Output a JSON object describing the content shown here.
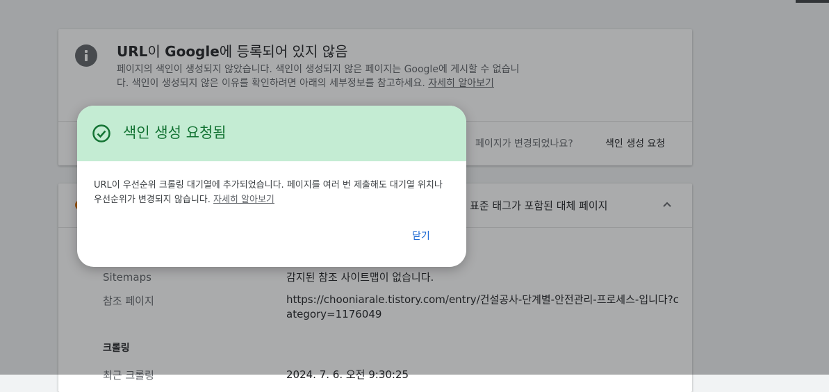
{
  "status_card": {
    "title_url": "URL",
    "title_mid": "이 ",
    "title_google": "Google",
    "title_rest": "에 등록되어 있지 않음",
    "description": "페이지의 색인이 생성되지 않았습니다. 색인이 생성되지 않은 페이지는 Google에 게시할 수 없습니다. 색인이 생성되지 않은 이유를 확인하려면 아래의 세부정보를 참고하세요. ",
    "learn_more": "자세히 알아보기",
    "changed_question": "페이지가 변경되었나요?",
    "request_indexing": "색인 생성 요청"
  },
  "detail_card": {
    "header": "표준 태그가 포함된 대체 페이지",
    "rows": [
      {
        "label": "Sitemaps",
        "value": "감지된 참조 사이트맵이 없습니다."
      },
      {
        "label": "참조 페이지",
        "value": "https://chooniarale.tistory.com/entry/건설공사-단계별-안전관리-프로세스-입니다?category=1176049"
      }
    ],
    "crawl_section": "크롤링",
    "last_crawl_label": "최근 크롤링",
    "last_crawl_value": "2024. 7. 6. 오전 9:30:25"
  },
  "dialog": {
    "title": "색인 생성 요청됨",
    "body": "URL이 우선순위 크롤링 대기열에 추가되었습니다. 페이지를 여러 번 제출해도 대기열 위치나 우선순위가 변경되지 않습니다. ",
    "learn_more": "자세히 알아보기",
    "close": "닫기",
    "header_color": "#c4ecd3",
    "accent_color": "#137333"
  }
}
